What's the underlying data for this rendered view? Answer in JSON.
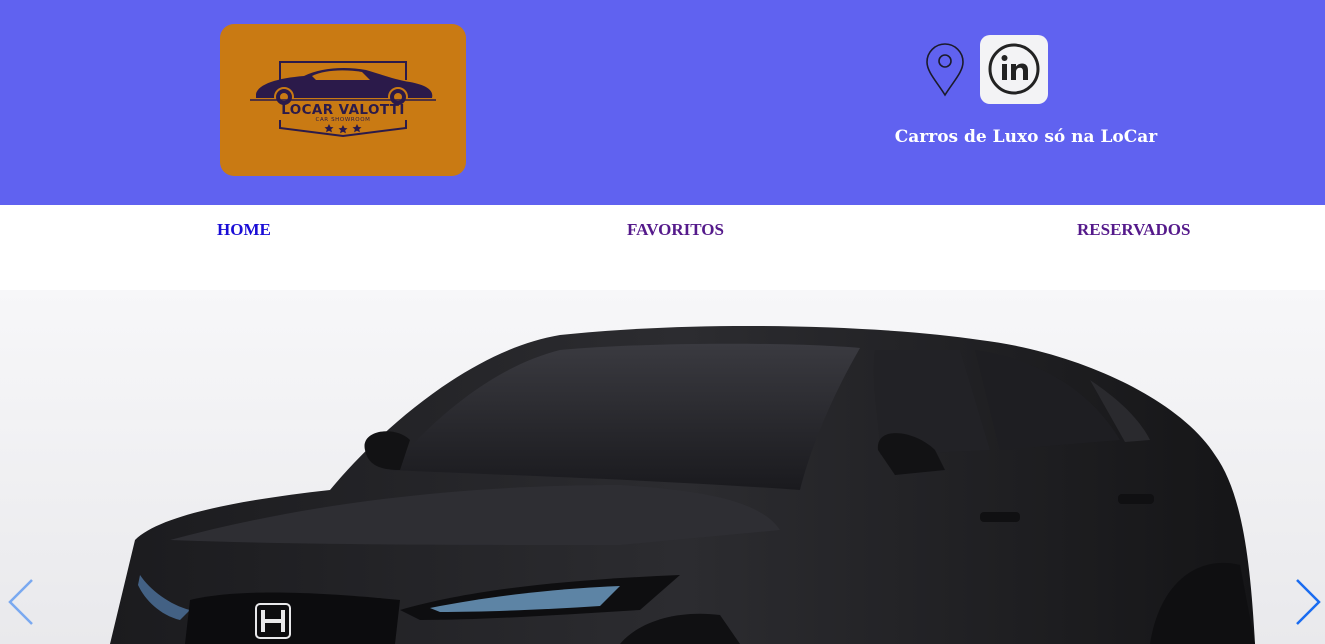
{
  "brand": {
    "logo_title": "LOCAR VALOTTI",
    "logo_subtitle": "CAR SHOWROOM",
    "logo_bg": "#c97a13",
    "header_bg": "#6062f0"
  },
  "header": {
    "tagline": "Carros de Luxo só na LoCar",
    "icons": [
      "location-pin-icon",
      "linkedin-icon"
    ]
  },
  "nav": {
    "items": [
      {
        "label": "HOME",
        "color": "#1a0dd6"
      },
      {
        "label": "FAVORITOS",
        "color": "#551a8b"
      },
      {
        "label": "RESERVADOS",
        "color": "#551a8b"
      }
    ]
  },
  "carousel": {
    "slide": "black-honda-hatchback",
    "prev_icon": "chevron-left-icon",
    "next_icon": "chevron-right-icon",
    "arrow_color": "#1a6cf0"
  }
}
